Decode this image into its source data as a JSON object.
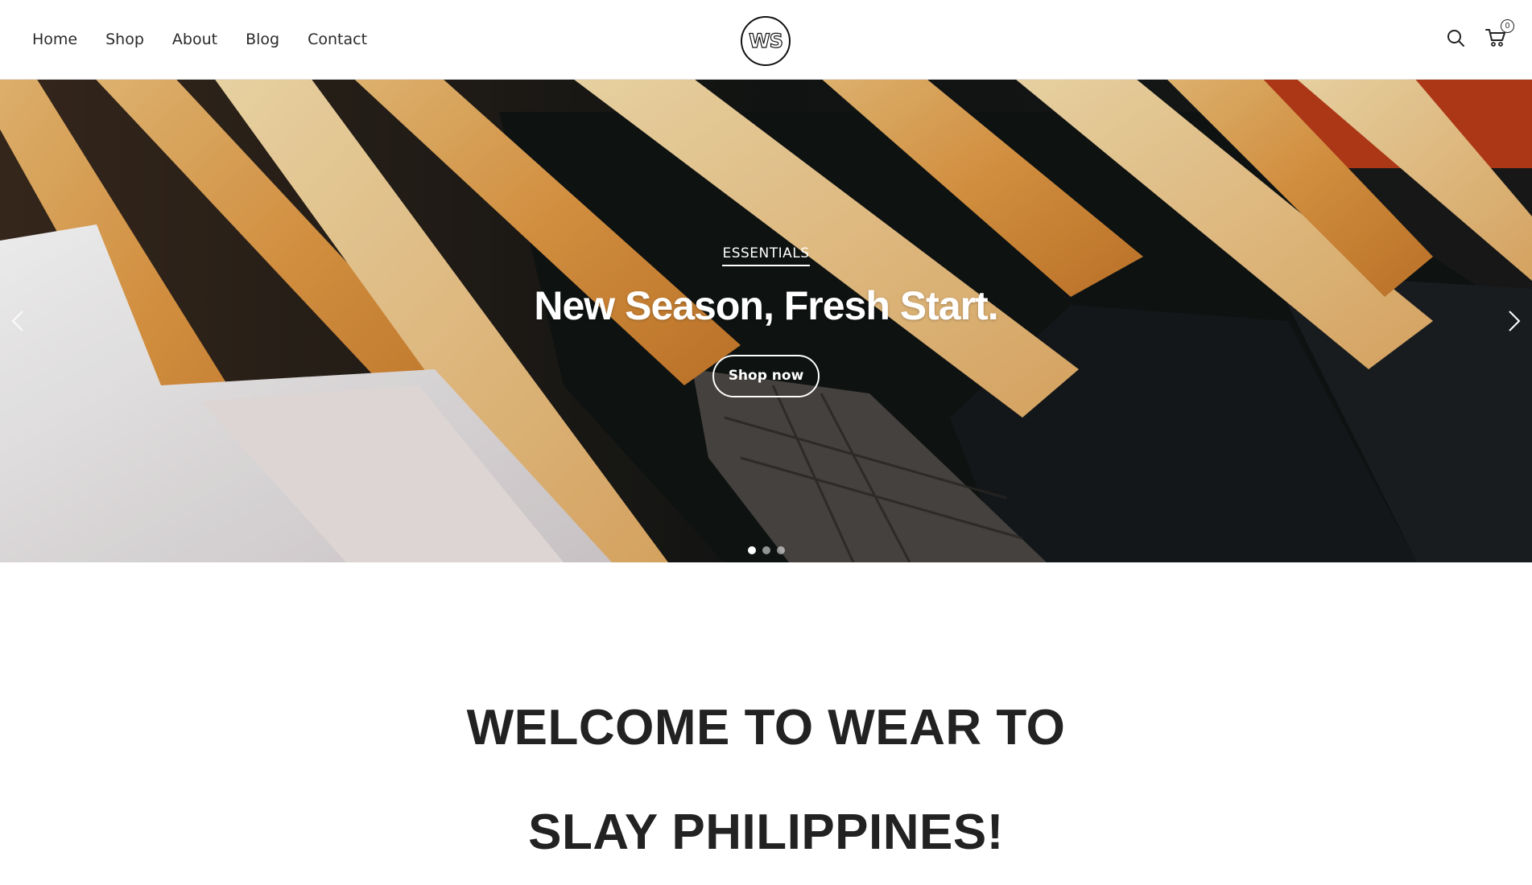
{
  "nav": {
    "items": [
      {
        "label": "Home"
      },
      {
        "label": "Shop"
      },
      {
        "label": "About"
      },
      {
        "label": "Blog"
      },
      {
        "label": "Contact"
      }
    ]
  },
  "logo": {
    "text": "WS"
  },
  "header_icons": {
    "search": "search-icon",
    "cart": "cart-icon",
    "cart_count": "0"
  },
  "hero": {
    "eyebrow": "ESSENTIALS",
    "title": "New Season, Fresh Start.",
    "button_label": "Shop now",
    "slides_total": 3,
    "active_slide": 1
  },
  "welcome": {
    "heading": "WELCOME TO WEAR TO SLAY PHILIPPINES!"
  },
  "colors": {
    "hanger": "#e0a052",
    "dark_garment": "#151515",
    "accent_red": "#d8431a"
  }
}
